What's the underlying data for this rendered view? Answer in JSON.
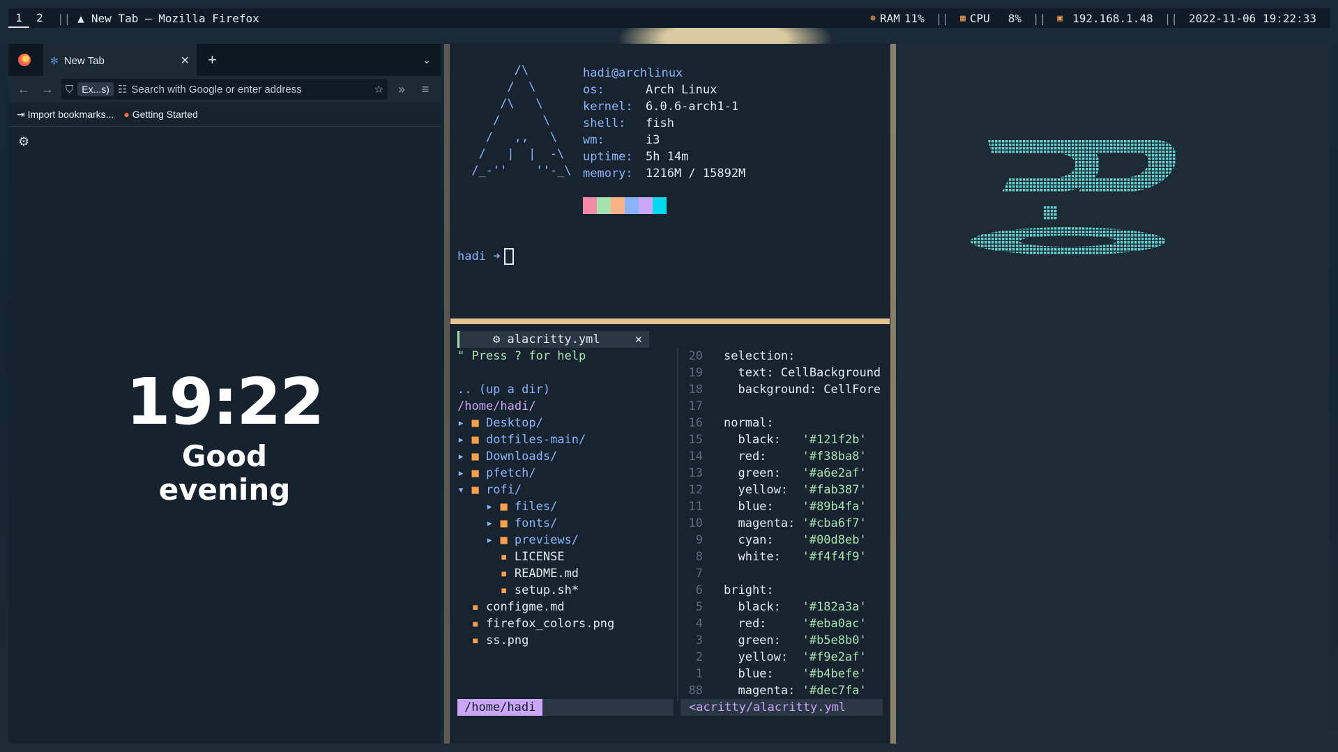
{
  "topbar": {
    "workspaces": [
      "1",
      "2"
    ],
    "window_title": "New Tab — Mozilla Firefox",
    "ram_label": "RAM",
    "ram_value": "11%",
    "cpu_label": "CPU",
    "cpu_value": "8%",
    "ip": "192.168.1.48",
    "datetime": "2022-11-06 19:22:33",
    "sep": "||"
  },
  "firefox": {
    "tab_title": "New Tab",
    "perm_label": "Ex...s)",
    "url_placeholder": "Search with Google or enter address",
    "bookmarks": [
      "Import bookmarks...",
      "Getting Started"
    ],
    "clock": "19:22",
    "greeting_line1": "Good",
    "greeting_line2": "evening"
  },
  "pfetch": {
    "user_host": "hadi@archlinux",
    "rows": [
      {
        "k": "os:",
        "v": "Arch Linux"
      },
      {
        "k": "kernel:",
        "v": "6.0.6-arch1-1"
      },
      {
        "k": "shell:",
        "v": "fish"
      },
      {
        "k": "wm:",
        "v": "i3"
      },
      {
        "k": "uptime:",
        "v": "5h 14m"
      },
      {
        "k": "memory:",
        "v": "1216M / 15892M"
      }
    ],
    "swatch_colors": [
      "#f38ba8",
      "#a6e2af",
      "#fab387",
      "#89b4fa",
      "#cba6f7",
      "#00d8eb"
    ],
    "prompt": "hadi ➜"
  },
  "vim": {
    "tab_name": "alacritty.yml",
    "help": "\" Press ? for help",
    "tree": [
      {
        "t": "dir",
        "text": ".. (up a dir)"
      },
      {
        "t": "path",
        "text": "/home/hadi/"
      },
      {
        "t": "folder",
        "indent": 0,
        "arrow": "▸",
        "name": "Desktop/"
      },
      {
        "t": "folder",
        "indent": 0,
        "arrow": "▸",
        "name": "dotfiles-main/"
      },
      {
        "t": "folder",
        "indent": 0,
        "arrow": "▸",
        "name": "Downloads/"
      },
      {
        "t": "folder",
        "indent": 0,
        "arrow": "▸",
        "name": "pfetch/"
      },
      {
        "t": "folder",
        "indent": 0,
        "arrow": "▾",
        "name": "rofi/"
      },
      {
        "t": "folder",
        "indent": 1,
        "arrow": "▸",
        "name": "files/"
      },
      {
        "t": "folder",
        "indent": 1,
        "arrow": "▸",
        "name": "fonts/"
      },
      {
        "t": "folder",
        "indent": 1,
        "arrow": "▸",
        "name": "previews/"
      },
      {
        "t": "file",
        "indent": 1,
        "name": "LICENSE"
      },
      {
        "t": "file",
        "indent": 1,
        "name": "README.md"
      },
      {
        "t": "file",
        "indent": 1,
        "name": "setup.sh*"
      },
      {
        "t": "file",
        "indent": 0,
        "name": "configme.md"
      },
      {
        "t": "file",
        "indent": 0,
        "name": "firefox_colors.png"
      },
      {
        "t": "file",
        "indent": 0,
        "name": "ss.png"
      }
    ],
    "code": [
      {
        "ln": "20",
        "text": "selection:"
      },
      {
        "ln": "19",
        "text": "  text: CellBackground"
      },
      {
        "ln": "18",
        "text": "  background: CellFore"
      },
      {
        "ln": "17",
        "text": ""
      },
      {
        "ln": "16",
        "text": "normal:"
      },
      {
        "ln": "15",
        "text": "  black:   ",
        "val": "'#121f2b'"
      },
      {
        "ln": "14",
        "text": "  red:     ",
        "val": "'#f38ba8'"
      },
      {
        "ln": "13",
        "text": "  green:   ",
        "val": "'#a6e2af'"
      },
      {
        "ln": "12",
        "text": "  yellow:  ",
        "val": "'#fab387'"
      },
      {
        "ln": "11",
        "text": "  blue:    ",
        "val": "'#89b4fa'"
      },
      {
        "ln": "10",
        "text": "  magenta: ",
        "val": "'#cba6f7'"
      },
      {
        "ln": "9",
        "text": "  cyan:    ",
        "val": "'#00d8eb'"
      },
      {
        "ln": "8",
        "text": "  white:   ",
        "val": "'#f4f4f9'"
      },
      {
        "ln": "7",
        "text": ""
      },
      {
        "ln": "6",
        "text": "bright:"
      },
      {
        "ln": "5",
        "text": "  black:   ",
        "val": "'#182a3a'"
      },
      {
        "ln": "4",
        "text": "  red:     ",
        "val": "'#eba0ac'"
      },
      {
        "ln": "3",
        "text": "  green:   ",
        "val": "'#b5e8b0'"
      },
      {
        "ln": "2",
        "text": "  yellow:  ",
        "val": "'#f9e2af'"
      },
      {
        "ln": "1",
        "text": "  blue:    ",
        "val": "'#b4befe'"
      },
      {
        "ln": "88",
        "text": "  magenta: ",
        "val": "'#dec7fa'"
      }
    ],
    "status_left": "/home/hadi",
    "status_right": "<acritty/alacritty.yml"
  }
}
